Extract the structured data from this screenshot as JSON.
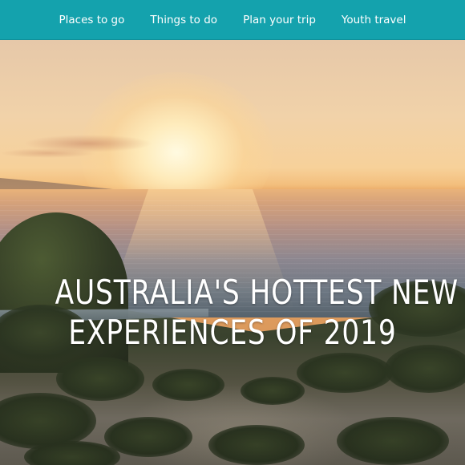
{
  "nav": {
    "items": [
      {
        "label": "Places to go"
      },
      {
        "label": "Things to do"
      },
      {
        "label": "Plan your trip"
      },
      {
        "label": "Youth travel"
      }
    ],
    "background_color": "#14a2ad"
  },
  "hero": {
    "headline_line1": "AUSTRALIA'S HOTTEST NEW",
    "headline_line2": "EXPERIENCES OF 2019"
  }
}
